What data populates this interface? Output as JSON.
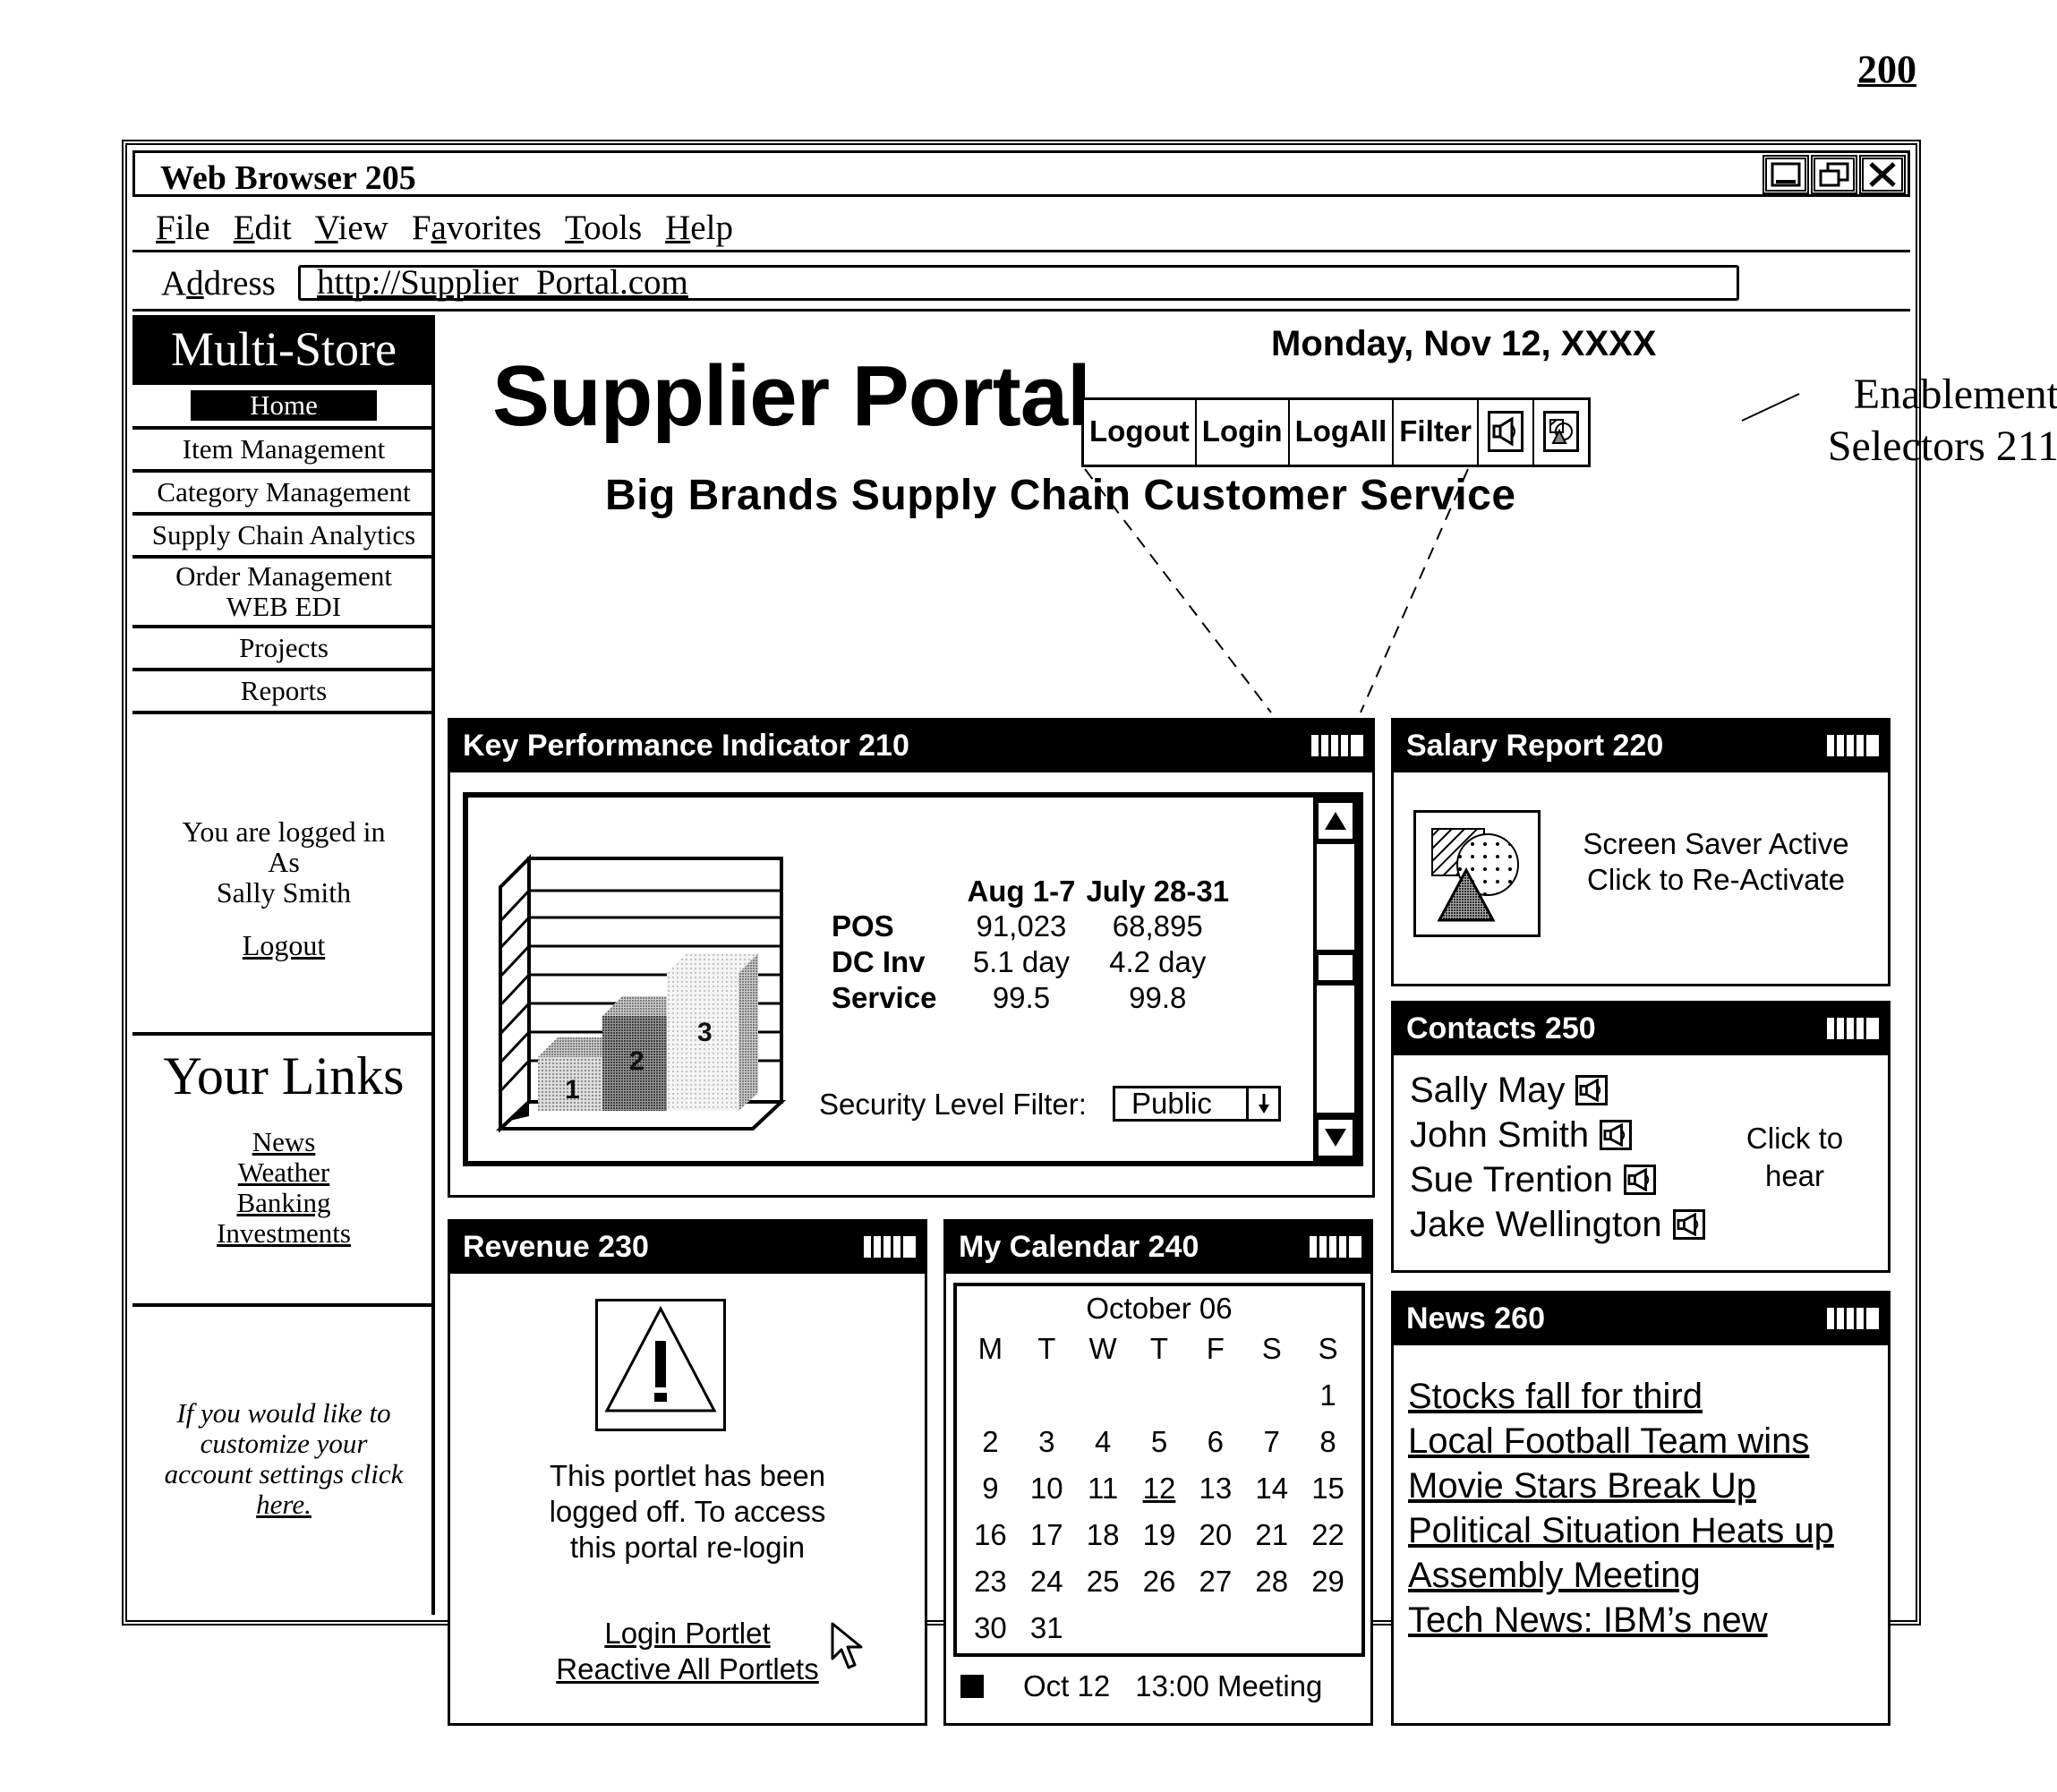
{
  "figure_number": "200",
  "window": {
    "title": "Web Browser 205",
    "controls": [
      "minimize-icon",
      "restore-icon",
      "close-icon"
    ]
  },
  "menu": [
    {
      "label": "File",
      "accel": "F",
      "rest": "ile"
    },
    {
      "label": "Edit",
      "accel": "E",
      "rest": "dit"
    },
    {
      "label": "View",
      "accel": "V",
      "rest": "iew"
    },
    {
      "label": "Favorites",
      "pre": "F",
      "accel": "a",
      "rest": "vorites"
    },
    {
      "label": "Tools",
      "accel": "T",
      "rest": "ools"
    },
    {
      "label": "Help",
      "accel": "H",
      "rest": "elp"
    }
  ],
  "address": {
    "label_pre": "A",
    "label_accel": "d",
    "label_rest": "dress",
    "url": "http://Supplier_Portal.com"
  },
  "sidebar": {
    "brand": "Multi-Store",
    "nav": [
      {
        "label": "Home",
        "active": true
      },
      {
        "label": "Item Management"
      },
      {
        "label": "Category Management"
      },
      {
        "label": "Supply Chain Analytics"
      },
      {
        "label": "Order Management",
        "label2": "WEB EDI"
      },
      {
        "label": "Projects"
      },
      {
        "label": "Reports"
      }
    ],
    "login": {
      "line1": "You are logged in",
      "line2": "As",
      "user": "Sally Smith",
      "logout": "Logout"
    },
    "links": {
      "heading": "Your Links",
      "items": [
        "News",
        "Weather",
        "Banking",
        "Investments"
      ]
    },
    "customize": {
      "line1": "If you would like to",
      "line2": "customize your",
      "line3": "account settings click",
      "link": "here."
    }
  },
  "header": {
    "title": "Supplier Portal",
    "date": "Monday, Nov 12, XXXX",
    "subtitle": "Big Brands Supply Chain Customer Service"
  },
  "enablement_selectors": {
    "buttons": [
      "Logout",
      "Login",
      "LogAll",
      "Filter"
    ],
    "icons": [
      "speaker-icon",
      "screensaver-icon"
    ],
    "annotation_line1": "Enablement",
    "annotation_line2": "Selectors 211"
  },
  "portlets": {
    "kpi": {
      "title": "Key Performance Indicator 210",
      "chart_bar_labels": [
        "1",
        "2",
        "3"
      ],
      "columns": [
        "",
        "Aug 1-7",
        "July 28-31"
      ],
      "rows": [
        {
          "label": "POS",
          "values": [
            "91,023",
            "68,895"
          ]
        },
        {
          "label": "DC Inv",
          "values": [
            "5.1 day",
            "4.2 day"
          ]
        },
        {
          "label": "Service",
          "values": [
            "99.5",
            "99.8"
          ]
        }
      ],
      "filter_label": "Security Level Filter:",
      "filter_value": "Public"
    },
    "salary": {
      "title": "Salary Report 220",
      "line1": "Screen Saver Active",
      "line2": "Click to Re-Activate"
    },
    "contacts": {
      "title": "Contacts 250",
      "names": [
        "Sally May",
        "John Smith",
        "Sue Trention",
        "Jake Wellington"
      ],
      "hint_line1": "Click to",
      "hint_line2": "hear"
    },
    "revenue": {
      "title": "Revenue 230",
      "msg_line1": "This portlet has been",
      "msg_line2": "logged off. To access",
      "msg_line3": "this portal re-login",
      "link1": "Login Portlet",
      "link2": "Reactive All Portlets"
    },
    "calendar": {
      "title": "My Calendar 240",
      "month": "October 06",
      "weekdays": [
        "M",
        "T",
        "W",
        "T",
        "F",
        "S",
        "S"
      ],
      "first_weekday_index": 6,
      "days_in_month": 31,
      "today": 12,
      "event_date": "Oct 12",
      "event_text": "13:00 Meeting"
    },
    "news": {
      "title": "News 260",
      "headlines": [
        "Stocks fall for third",
        "Local Football Team wins",
        "Movie Stars Break Up",
        "Political Situation Heats up",
        "Assembly Meeting",
        "Tech News: IBM’s new"
      ]
    }
  }
}
